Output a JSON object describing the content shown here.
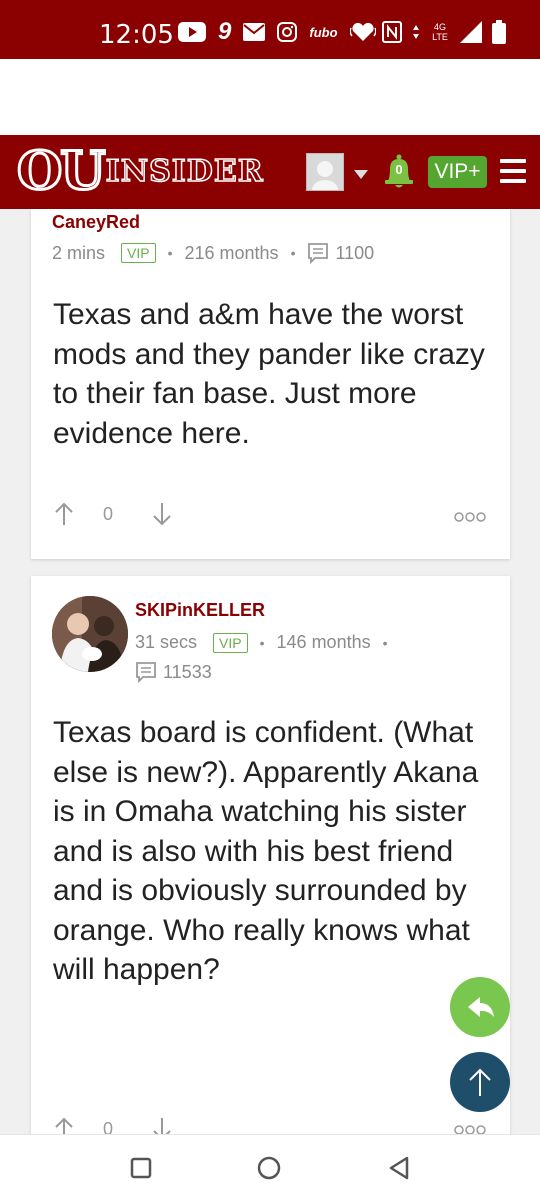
{
  "status_bar": {
    "time": "12:05",
    "network": "4G LTE",
    "icons": [
      "youtube-icon",
      "nine-icon",
      "mail-icon",
      "instagram-icon",
      "fubo-icon",
      "iheart-icon",
      "nfc-icon",
      "data-arrows-icon",
      "signal-icon",
      "battery-icon"
    ],
    "fubo_label": "fubo",
    "nine_label": "9"
  },
  "header": {
    "logo_ou": "OU",
    "logo_insider": "INSIDER",
    "notification_count": "0",
    "vip_button": "VIP+"
  },
  "comments": [
    {
      "username": "CaneyRed",
      "time": "2 mins",
      "badge": "VIP",
      "months": "216 months",
      "post_count": "1100",
      "text": "Texas and a&m have the worst mods and they pander like crazy to their fan base. Just more evidence here.",
      "votes": "0"
    },
    {
      "username": "SKIPinKELLER",
      "time": "31 secs",
      "badge": "VIP",
      "months": "146 months",
      "post_count": "11533",
      "text": "Texas board is confident. (What else is new?). Apparently Akana is in Omaha watching his sister and is also with his best friend and is obviously surrounded by orange. Who really knows what will happen?",
      "votes": "0"
    }
  ],
  "colors": {
    "brand": "#8b0000",
    "vip_green": "#55a630",
    "reply_fab": "#7ac74f",
    "top_fab": "#1f4e6b"
  }
}
